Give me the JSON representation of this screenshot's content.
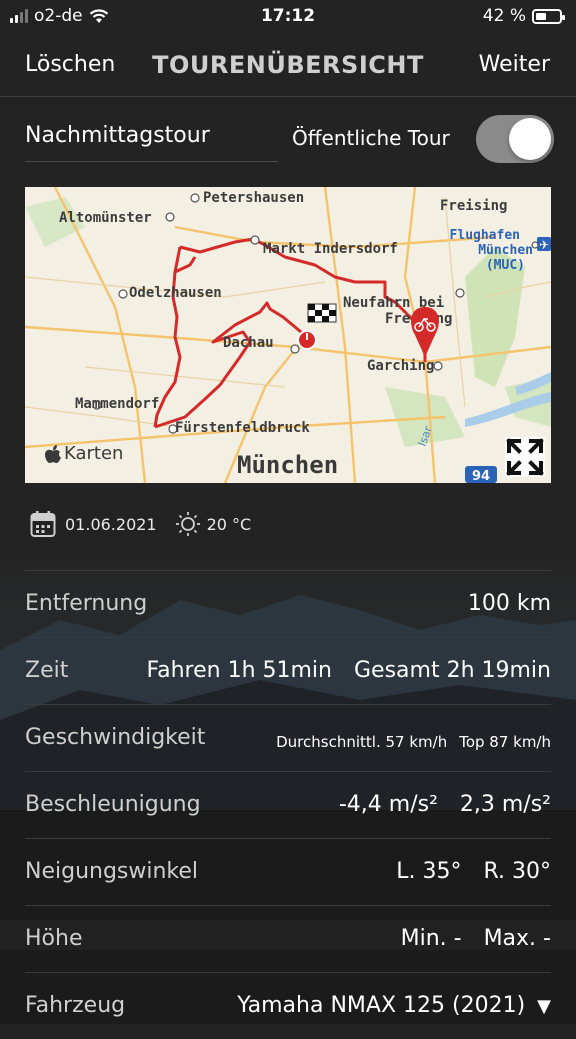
{
  "status": {
    "carrier": "o2-de",
    "time": "17:12",
    "battery": "42 %"
  },
  "nav": {
    "left": "Löschen",
    "title": "TOURENÜBERSICHT",
    "right": "Weiter"
  },
  "tour": {
    "name": "Nachmittagstour",
    "public_label": "Öffentliche Tour",
    "public_on": true
  },
  "map": {
    "brand": "Karten",
    "places": {
      "petershausen": "Petershausen",
      "altomuenster": "Altomünster",
      "freising": "Freising",
      "markt": "Markt Indersdorf",
      "flughafen1": "Flughafen",
      "flughafen2": "München",
      "flughafen3": "(MUC)",
      "odelz": "Odelzhausen",
      "neufahrn1": "Neufahrn bei",
      "neufahrn2": "Freising",
      "dachau": "Dachau",
      "garching": "Garching",
      "mammendorf": "Mammendorf",
      "fursten": "Fürstenfeldbruck",
      "muenchen": "München",
      "isar": "Isar",
      "highway": "94"
    }
  },
  "info": {
    "date": "01.06.2021",
    "temp": "20 °C"
  },
  "stats": {
    "distance": {
      "label": "Entfernung",
      "value": "100 km"
    },
    "time": {
      "label": "Zeit",
      "ride": "Fahren 1h 51min",
      "total": "Gesamt 2h 19min"
    },
    "speed": {
      "label": "Geschwindigkeit",
      "avg": "Durchschnittl. 57 km/h",
      "top": "Top 87 km/h"
    },
    "accel": {
      "label": "Beschleunigung",
      "neg": "-4,4 m/s²",
      "pos": "2,3 m/s²"
    },
    "lean": {
      "label": "Neigungswinkel",
      "left": "L. 35°",
      "right": "R. 30°"
    },
    "altitude": {
      "label": "Höhe",
      "min": "Min. -",
      "max": "Max. -"
    },
    "vehicle": {
      "label": "Fahrzeug",
      "value": "Yamaha NMAX 125 (2021)"
    }
  }
}
